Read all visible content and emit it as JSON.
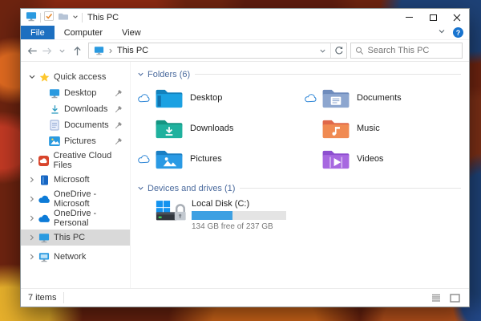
{
  "titlebar": {
    "title": "This PC"
  },
  "ribbon": {
    "tabs": [
      {
        "label": "File",
        "active": true
      },
      {
        "label": "Computer",
        "active": false
      },
      {
        "label": "View",
        "active": false
      }
    ],
    "help_glyph": "?"
  },
  "address_bar": {
    "location": "This PC",
    "search_placeholder": "Search This PC"
  },
  "sidebar": {
    "items": [
      {
        "label": "Quick access",
        "icon": "star",
        "chevron": "expanded",
        "level": 0,
        "pinned": false,
        "selected": false
      },
      {
        "label": "Desktop",
        "icon": "monitor",
        "chevron": "none",
        "level": 1,
        "pinned": true,
        "selected": false
      },
      {
        "label": "Downloads",
        "icon": "download",
        "chevron": "none",
        "level": 1,
        "pinned": true,
        "selected": false
      },
      {
        "label": "Documents",
        "icon": "document",
        "chevron": "none",
        "level": 1,
        "pinned": true,
        "selected": false
      },
      {
        "label": "Pictures",
        "icon": "picture",
        "chevron": "none",
        "level": 1,
        "pinned": true,
        "selected": false
      },
      {
        "label": "Creative Cloud Files",
        "icon": "creative-cloud",
        "chevron": "collapsed",
        "level": 0,
        "pinned": false,
        "selected": false
      },
      {
        "label": "Microsoft",
        "icon": "microsoft",
        "chevron": "collapsed",
        "level": 0,
        "pinned": false,
        "selected": false
      },
      {
        "label": "OneDrive - Microsoft",
        "icon": "cloud",
        "chevron": "collapsed",
        "level": 0,
        "pinned": false,
        "selected": false
      },
      {
        "label": "OneDrive - Personal",
        "icon": "cloud",
        "chevron": "collapsed",
        "level": 0,
        "pinned": false,
        "selected": false
      },
      {
        "label": "This PC",
        "icon": "pc",
        "chevron": "collapsed",
        "level": 0,
        "pinned": false,
        "selected": true
      },
      {
        "label": "Network",
        "icon": "network",
        "chevron": "collapsed",
        "level": 0,
        "pinned": false,
        "selected": false
      }
    ]
  },
  "content": {
    "folders_group": {
      "label": "Folders (6)",
      "expanded": true
    },
    "folders": [
      {
        "name": "Desktop",
        "cloud": true,
        "glyph": "desktop",
        "color_tab": "#1382bd",
        "color_body": "#1ba1e2"
      },
      {
        "name": "Documents",
        "cloud": true,
        "glyph": "documents",
        "color_tab": "#6f8cbd",
        "color_body": "#8da6cf"
      },
      {
        "name": "Downloads",
        "cloud": false,
        "glyph": "downloads",
        "color_tab": "#149582",
        "color_body": "#1fb19e"
      },
      {
        "name": "Music",
        "cloud": false,
        "glyph": "music",
        "color_tab": "#e0684a",
        "color_body": "#f08a52"
      },
      {
        "name": "Pictures",
        "cloud": true,
        "glyph": "pictures",
        "color_tab": "#1a7fc4",
        "color_body": "#2a9ae4"
      },
      {
        "name": "Videos",
        "cloud": false,
        "glyph": "videos",
        "color_tab": "#8d4fd0",
        "color_body": "#a768e0"
      }
    ],
    "drives_group": {
      "label": "Devices and drives (1)",
      "expanded": true
    },
    "drives": [
      {
        "name": "Local Disk (C:)",
        "free_text": "134 GB free of 237 GB",
        "used_percent": 43.5,
        "bar_color": "#3da0e2",
        "locked": true
      }
    ]
  },
  "status_bar": {
    "items_text": "7 items"
  }
}
